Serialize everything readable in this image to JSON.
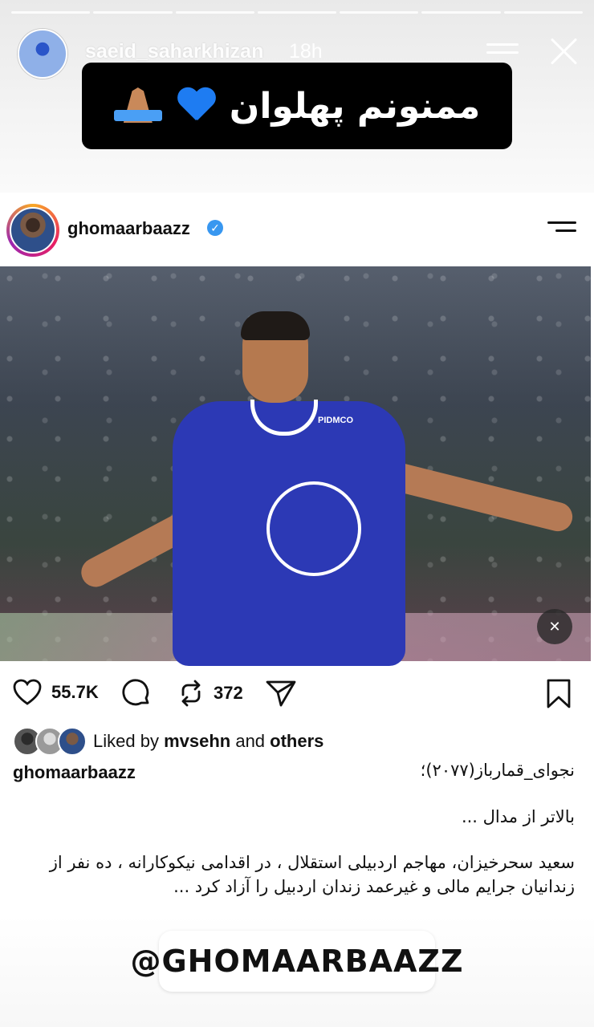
{
  "story": {
    "username": "saeid_saharkhizan",
    "time": "18h",
    "segments": 7,
    "caption_sticker": {
      "text": "ممنونم پهلوان",
      "emojis": [
        "folded-hands-icon",
        "blue-heart-icon"
      ]
    },
    "mention_sticker": "@GHOMAARBAAZZ"
  },
  "post": {
    "username": "ghomaarbaazz",
    "verified": true,
    "media": {
      "sponsor_text": "PIDMCO"
    },
    "actions": {
      "likes": "55.7K",
      "reposts": "372"
    },
    "liked_by": {
      "prefix": "Liked by ",
      "user": "mvsehn",
      "middle": " and ",
      "others": "others"
    },
    "caption": {
      "user": "ghomaarbaazz",
      "line1": "نجوای_قمارباز(۲۰۷۷)؛",
      "line2": "بالاتر از مدال ...",
      "paragraph": "سعید سحرخیزان، مهاجم اردبیلی استقلال ، در اقدامی نیکوکارانه ، ده نفر از زندانیان جرایم مالی و غیرعمد زندان اردبیل را آزاد کرد ..."
    }
  },
  "colors": {
    "verified": "#3897f0",
    "jersey": "#2c39b5",
    "sticker_bg": "#000000"
  }
}
